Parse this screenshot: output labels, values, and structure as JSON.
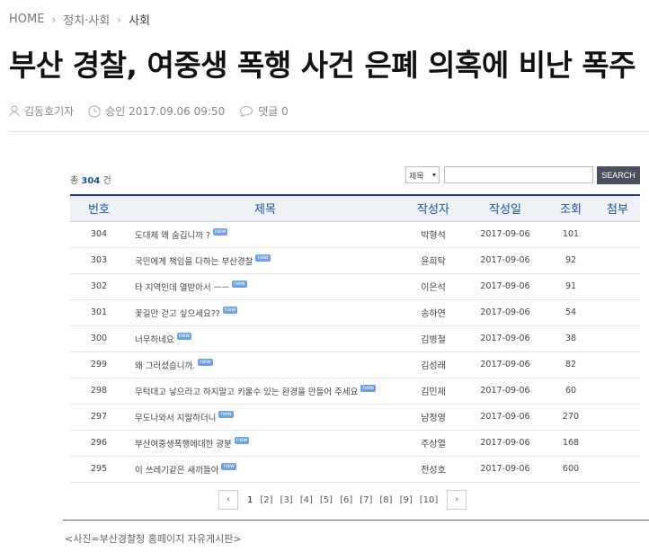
{
  "breadcrumb": {
    "home": "HOME",
    "section": "정치·사회",
    "current": "사회"
  },
  "headline": "부산 경찰, 여중생 폭행 사건 은폐 의혹에 비난 폭주",
  "byline": {
    "author": "김동호기자",
    "approved": "승인 2017.09.06 09:50",
    "comments": "댓글 0"
  },
  "board": {
    "total_prefix": "총",
    "total_count": "304",
    "total_suffix": "건",
    "search_select": "제목",
    "search_value": "",
    "search_button": "SEARCH",
    "columns": [
      "번호",
      "제목",
      "작성자",
      "작성일",
      "조회",
      "첨부"
    ],
    "new_badge": "new",
    "rows": [
      {
        "num": "304",
        "title": "도대체 왜 숨깁니까 ?",
        "author": "박형석",
        "date": "2017-09-06",
        "views": "101"
      },
      {
        "num": "303",
        "title": "국민에게 책임을 다하는 부산경찰",
        "author": "윤희탁",
        "date": "2017-09-06",
        "views": "92"
      },
      {
        "num": "302",
        "title": "타 지역인데 열받아서 ㅡㅡ",
        "author": "이은석",
        "date": "2017-09-06",
        "views": "91"
      },
      {
        "num": "301",
        "title": "꽃길만 걷고 싶으세요??",
        "author": "송하연",
        "date": "2017-09-06",
        "views": "54"
      },
      {
        "num": "300",
        "title": "너무하네요",
        "author": "김병철",
        "date": "2017-09-06",
        "views": "38"
      },
      {
        "num": "299",
        "title": "왜 그러셨습니까.",
        "author": "김성래",
        "date": "2017-09-06",
        "views": "82"
      },
      {
        "num": "298",
        "title": "무턱대고 낳으라고 하지말고 키울수 있는 환경을 만들어 주세요",
        "author": "김민제",
        "date": "2017-09-06",
        "views": "60"
      },
      {
        "num": "297",
        "title": "무도나와서 지랄하더니",
        "author": "남정영",
        "date": "2017-09-06",
        "views": "270"
      },
      {
        "num": "296",
        "title": "부산여중생폭행에대한 광분",
        "author": "주상열",
        "date": "2017-09-06",
        "views": "168"
      },
      {
        "num": "295",
        "title": "이 쓰레기같은 새끼들아",
        "author": "전성호",
        "date": "2017-09-06",
        "views": "600"
      }
    ]
  },
  "pagination": {
    "prev": "‹",
    "next": "›",
    "pages": [
      "1",
      "[2]",
      "[3]",
      "[4]",
      "[5]",
      "[6]",
      "[7]",
      "[8]",
      "[9]",
      "[10]"
    ]
  },
  "caption": "<사진=부산경찰청 홈페이지 자유게시판>"
}
